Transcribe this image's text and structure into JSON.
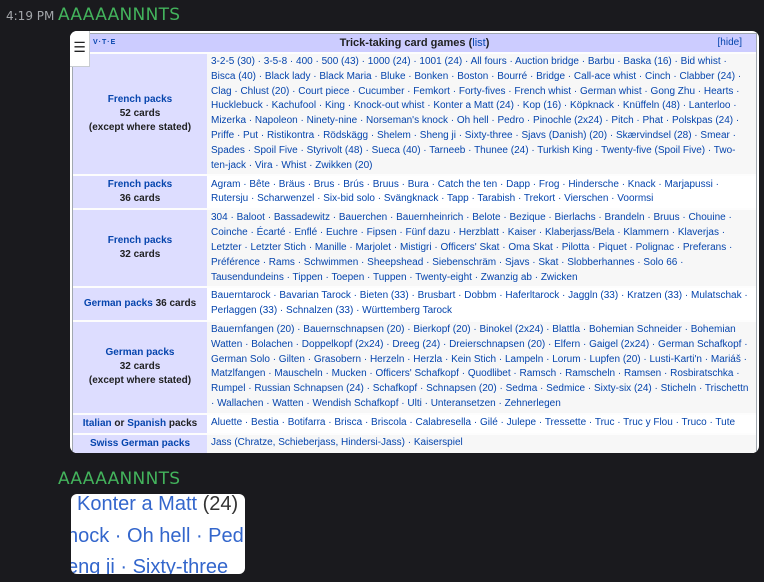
{
  "message1": {
    "time": "4:19 PM",
    "user": "AAAAANNNTS"
  },
  "message2": {
    "user": "AAAAANNNTS"
  },
  "navbox": {
    "vte": "V·T·E",
    "title": "Trick-taking card games",
    "title_link": "list",
    "hide": "[hide]",
    "menu_glyph": "☰",
    "rows": [
      {
        "h1": "French packs",
        "h2": "52 cards",
        "h3": "(except where stated)",
        "text": "3-2-5 (30) · 3-5-8 · 400 · 500 (43) · 1000 (24) · 1001 (24) · All fours · Auction bridge · Barbu · Baska (16) · Bid whist · Bisca (40) · Black lady · Black Maria · Bluke · Bonken · Boston · Bourré · Bridge · Call-ace whist · Cinch · Clabber (24) · Clag · Chlust (20) · Court piece · Cucumber · Femkort · Forty-fives · French whist · German whist · Gong Zhu · Hearts · Hucklebuck · Kachufool · King · Knock-out whist · Konter a Matt (24) · Kop (16) · Köpknack · Knüffeln (48) · Lanterloo · Mizerka · Napoleon · Ninety-nine · Norseman's knock · Oh hell · Pedro · Pinochle (2x24) · Pitch · Phat · Polskpas (24) · Priffe · Put · Ristikontra · Rödskägg · Shelem · Sheng ji · Sixty-three · Sjavs (Danish) (20) · Skærvindsel (28) · Smear · Spades · Spoil Five · Styrivolt (48) · Sueca (40) · Tarneeb · Thunee (24) · Turkish King · Twenty-five (Spoil Five) · Two-ten-jack · Vira · Whist · Zwikken (20)"
      },
      {
        "h1": "French packs",
        "h2": "36 cards",
        "h3": "",
        "text": "Agram · Bête · Bräus · Brus · Brús · Bruus · Bura · Catch the ten · Dapp · Frog · Hindersche · Knack · Marjapussi · Rutersju · Scharwenzel · Six-bid solo · Svängknack · Tapp · Tarabish · Trekort · Vierschen · Voormsi"
      },
      {
        "h1": "French packs",
        "h2": "32 cards",
        "h3": "",
        "text": "304 · Baloot · Bassadewitz · Bauerchen · Bauernheinrich · Belote · Bezique · Bierlachs · Brandeln · Bruus · Chouine · Coinche · Écarté · Enflé · Euchre · Fipsen · Fünf dazu · Herzblatt · Kaiser · Klaberjass/Bela · Klammern · Klaverjas · Letzter · Letzter Stich · Manille · Marjolet · Mistigri · Officers' Skat · Oma Skat · Pilotta · Piquet · Polignac · Preferans · Préférence · Rams · Schwimmen · Sheepshead · Siebenschräm · Sjavs · Skat · Slobberhannes · Solo 66 · Tausendundeins · Tippen · Toepen · Tuppen · Twenty-eight · Zwanzig ab · Zwicken"
      },
      {
        "h1": "German packs",
        "h2": "36 cards",
        "h3": "",
        "inline": true,
        "text": "Bauerntarock · Bavarian Tarock · Bieten (33) · Brusbart · Dobbm · Haferltarock · Jaggln (33) · Kratzen (33) · Mulatschak · Perlaggen (33) · Schnalzen (33) · Württemberg Tarock"
      },
      {
        "h1": "German packs",
        "h2": "32 cards",
        "h3": "(except where stated)",
        "text": "Bauernfangen (20) · Bauernschnapsen (20) · Bierkopf (20) · Binokel (2x24) · Blattla · Bohemian Schneider · Bohemian Watten · Bolachen · Doppelkopf (2x24) · Dreeg (24) · Dreierschnapsen (20) · Elfern · Gaigel (2x24) · German Schafkopf · German Solo · Gilten · Grasobern · Herzeln · Herzla · Kein Stich · Lampeln · Lorum · Lupfen (20) · Lusti-Karti'n · Mariáš · Matzlfangen · Mauscheln · Mucken · Officers' Schafkopf · Quodlibet · Ramsch · Ramscheln · Ramsen · Rosbiratschka · Rumpel · Russian Schnapsen (24) · Schafkopf · Schnapsen (20) · Sedma · Sedmice · Sixty-six (24) · Sticheln · Trischettn · Wallachen · Watten · Wendish Schafkopf · Ulti · Unteransetzen · Zehnerlegen"
      },
      {
        "h1": "Italian",
        "hor": " or ",
        "h1b": "Spanish",
        "h2": " packs",
        "h3": "",
        "inline": true,
        "text": "Aluette · Bestia · Botifarra · Brisca · Briscola · Calabresella · Gilé · Julepe · Tressette · Truc · Truc y Flou · Truco · Tute"
      },
      {
        "h1": "Swiss German packs",
        "h2": "",
        "h3": "",
        "inline": true,
        "text": "Jass (Chratze, Schieberjass, Hindersi-Jass) · Kaiserspiel"
      }
    ]
  },
  "zoom": {
    "line1a": "Konter a Matt",
    "line1b": " (24)",
    "line2": "nock · Oh hell · Ped",
    "line3": "eng ji · Sixty-three"
  }
}
